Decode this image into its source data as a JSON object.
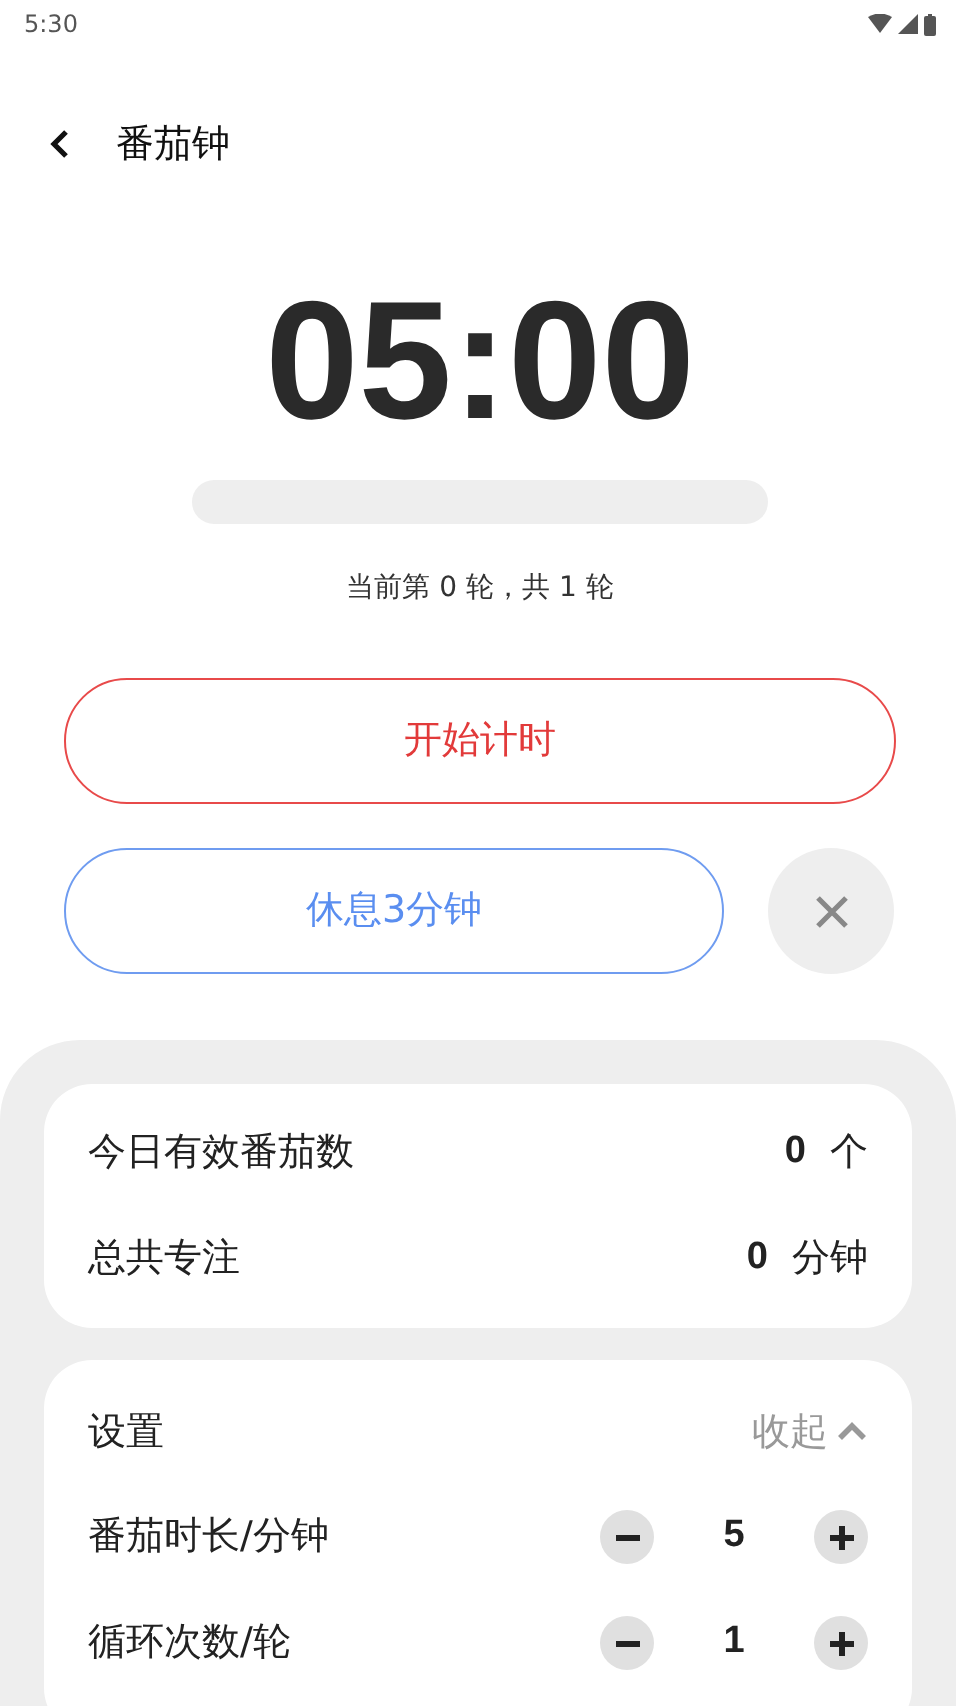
{
  "status_bar": {
    "time": "5:30"
  },
  "header": {
    "title": "番茄钟"
  },
  "timer": {
    "display": "05:00",
    "level": 0,
    "round_text": "当前第 0 轮，共 1 轮"
  },
  "buttons": {
    "start": "开始计时",
    "rest": "休息3分钟"
  },
  "stats": [
    {
      "label": "今日有效番茄数",
      "value": "0",
      "unit": "个"
    },
    {
      "label": "总共专注",
      "value": "0",
      "unit": "分钟"
    }
  ],
  "settings": {
    "title": "设置",
    "toggle_label": "收起",
    "expanded": true,
    "rows": [
      {
        "label": "番茄时长/分钟",
        "value": "5"
      },
      {
        "label": "循环次数/轮",
        "value": "1"
      }
    ]
  }
}
